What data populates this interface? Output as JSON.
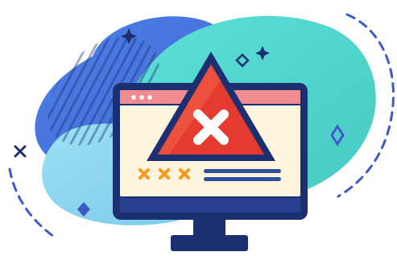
{
  "illustration": {
    "subject": "monitor-error-warning",
    "icons": {
      "warning": "warning-triangle-icon",
      "error": "close-x-icon",
      "window_controls": "window-dots-icon",
      "stars": "sparkle-star-icon",
      "diamonds": "diamond-icon",
      "crosses": "small-x-icon"
    },
    "colors": {
      "blob_blue": "#3f6fd6",
      "blob_teal": "#4fd6cf",
      "blob_light": "#86d9ef",
      "dark_navy": "#1c2f70",
      "dashed_stroke": "#3f59c9",
      "window_header": "#f08b8f",
      "window_body": "#fff4dd",
      "warning_red": "#e53a2f",
      "error_mark": "#ffffff",
      "orange_marks": "#f59a1a",
      "text_lines": "#2f4f9a"
    }
  }
}
